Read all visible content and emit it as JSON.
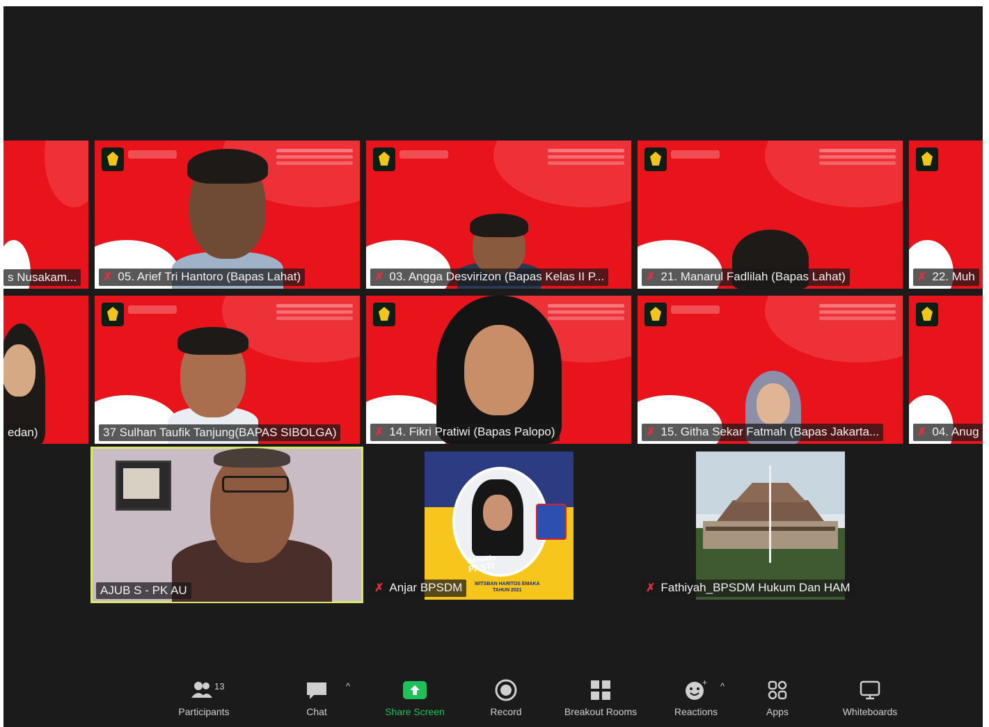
{
  "participants_tiles": [
    {
      "name": "s Nusakam..."
    },
    {
      "name": "05. Arief Tri Hantoro (Bapas Lahat)"
    },
    {
      "name": "03. Angga Desvirizon (Bapas Kelas II P..."
    },
    {
      "name": "21. Manarul Fadlilah (Bapas Lahat)"
    },
    {
      "name": "22. Muh"
    },
    {
      "name": "edan)"
    },
    {
      "name": "37 Sulhan Taufik Tanjung(BAPAS SIBOLGA)"
    },
    {
      "name": "14. Fikri Pratiwi (Bapas Palopo)"
    },
    {
      "name": "15. Githa Sekar Fatmah (Bapas Jakarta..."
    },
    {
      "name": "04. Anug"
    },
    {
      "name": "AJUB S - PK AU"
    },
    {
      "name": "Anjar BPSDM"
    },
    {
      "name": "Fathiyah_BPSDM Hukum Dan HAM"
    }
  ],
  "poster": {
    "line1": "Semakin",
    "line2": "PASTI",
    "footer1": "WITSBAN HARITOS EMAKA",
    "footer2": "TAHUN 2021"
  },
  "toolbar": {
    "participants_label": "Participants",
    "participants_count": "13",
    "chat_label": "Chat",
    "share_label": "Share Screen",
    "record_label": "Record",
    "breakout_label": "Breakout Rooms",
    "reactions_label": "Reactions",
    "apps_label": "Apps",
    "whiteboards_label": "Whiteboards"
  },
  "colors": {
    "background": "#1b1b1b",
    "tile_red": "#e8131b",
    "active_speaker": "#d9e86a",
    "share_green": "#1fbf5a",
    "mic_muted": "#e8303a"
  }
}
